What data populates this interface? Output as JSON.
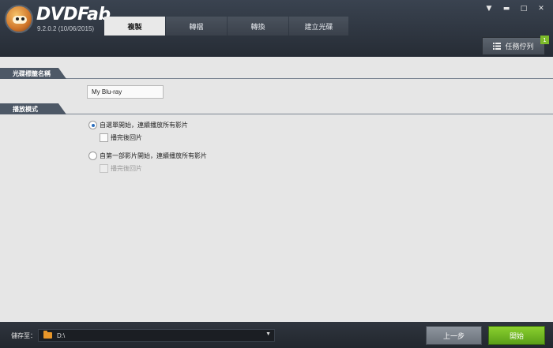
{
  "app": {
    "brand": "DVDFab",
    "version": "9.2.0.2 (10/06/2015)"
  },
  "tabs": [
    {
      "label": "複製",
      "active": true
    },
    {
      "label": "轉檔",
      "active": false
    },
    {
      "label": "轉換",
      "active": false
    },
    {
      "label": "建立光碟",
      "active": false
    }
  ],
  "window_controls": {
    "menu": "▼",
    "minimize": "▬",
    "maximize": "□",
    "close": "✕"
  },
  "task_queue": {
    "label": "任務佇列",
    "count": "1"
  },
  "disc_label_section": {
    "title": "光碟標籤名稱",
    "value": "My Blu-ray"
  },
  "play_mode_section": {
    "title": "播放模式",
    "options": [
      {
        "label": "自選單開始，連續播放所有影片",
        "checked": true,
        "sub_label": "播完後回片",
        "sub_checked": false,
        "sub_enabled": true
      },
      {
        "label": "自第一部影片開始，連續播放所有影片",
        "checked": false,
        "sub_label": "播完後回片",
        "sub_checked": false,
        "sub_enabled": false
      }
    ]
  },
  "bottom": {
    "save_to_label": "儲存至：",
    "save_path": "D:\\",
    "prev_label": "上一步",
    "start_label": "開始"
  },
  "colors": {
    "accent_green": "#7dbb2a",
    "title_bar": "#2c323b",
    "section_label": "#4d5866"
  }
}
